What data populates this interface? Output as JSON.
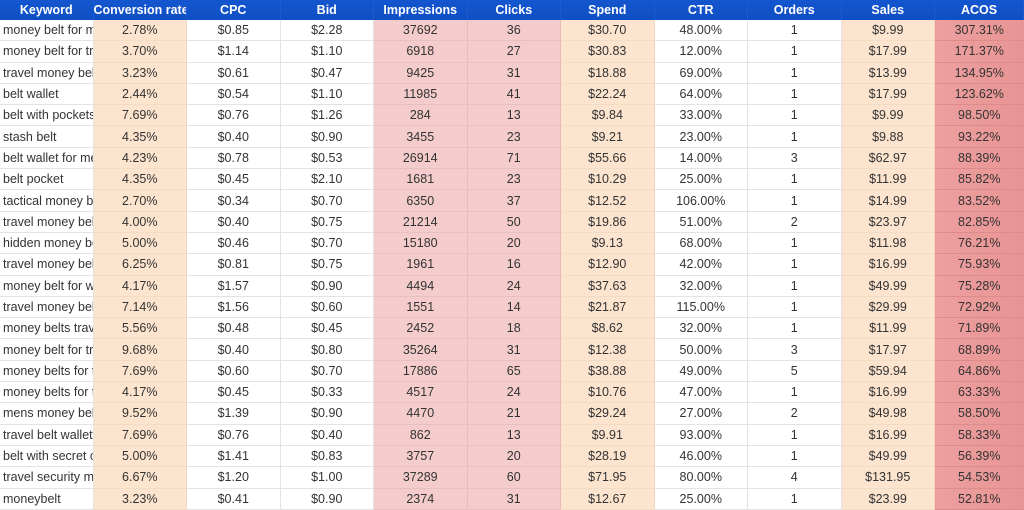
{
  "table": {
    "columns": [
      "Keyword",
      "Conversion rate",
      "CPC",
      "Bid",
      "Impressions",
      "Clicks",
      "Spend",
      "CTR",
      "Orders",
      "Sales",
      "ACOS"
    ],
    "colors": {
      "header_bg": "#1155cc",
      "header_text": "#ffffff",
      "peach": "#fce4cf",
      "pink": "#f4cccc",
      "acos_red": "#ea9999"
    },
    "rows": [
      [
        "money belt for men",
        "2.78%",
        "$0.85",
        "$2.28",
        "37692",
        "36",
        "$30.70",
        "48.00%",
        "1",
        "$9.99",
        "307.31%"
      ],
      [
        "money belt for travel",
        "3.70%",
        "$1.14",
        "$1.10",
        "6918",
        "27",
        "$30.83",
        "12.00%",
        "1",
        "$17.99",
        "171.37%"
      ],
      [
        "travel money belt",
        "3.23%",
        "$0.61",
        "$0.47",
        "9425",
        "31",
        "$18.88",
        "69.00%",
        "1",
        "$13.99",
        "134.95%"
      ],
      [
        "belt wallet",
        "2.44%",
        "$0.54",
        "$1.10",
        "11985",
        "41",
        "$22.24",
        "64.00%",
        "1",
        "$17.99",
        "123.62%"
      ],
      [
        "belt with pockets",
        "7.69%",
        "$0.76",
        "$1.26",
        "284",
        "13",
        "$9.84",
        "33.00%",
        "1",
        "$9.99",
        "98.50%"
      ],
      [
        "stash belt",
        "4.35%",
        "$0.40",
        "$0.90",
        "3455",
        "23",
        "$9.21",
        "23.00%",
        "1",
        "$9.88",
        "93.22%"
      ],
      [
        "belt wallet for men",
        "4.23%",
        "$0.78",
        "$0.53",
        "26914",
        "71",
        "$55.66",
        "14.00%",
        "3",
        "$62.97",
        "88.39%"
      ],
      [
        "belt pocket",
        "4.35%",
        "$0.45",
        "$2.10",
        "1681",
        "23",
        "$10.29",
        "25.00%",
        "1",
        "$11.99",
        "85.82%"
      ],
      [
        "tactical money belt",
        "2.70%",
        "$0.34",
        "$0.70",
        "6350",
        "37",
        "$12.52",
        "106.00%",
        "1",
        "$14.99",
        "83.52%"
      ],
      [
        "travel money belt",
        "4.00%",
        "$0.40",
        "$0.75",
        "21214",
        "50",
        "$19.86",
        "51.00%",
        "2",
        "$23.97",
        "82.85%"
      ],
      [
        "hidden money belt",
        "5.00%",
        "$0.46",
        "$0.70",
        "15180",
        "20",
        "$9.13",
        "68.00%",
        "1",
        "$11.98",
        "76.21%"
      ],
      [
        "travel money belt",
        "6.25%",
        "$0.81",
        "$0.75",
        "1961",
        "16",
        "$12.90",
        "42.00%",
        "1",
        "$16.99",
        "75.93%"
      ],
      [
        "money belt for women",
        "4.17%",
        "$1.57",
        "$0.90",
        "4494",
        "24",
        "$37.63",
        "32.00%",
        "1",
        "$49.99",
        "75.28%"
      ],
      [
        "travel money belt",
        "7.14%",
        "$1.56",
        "$0.60",
        "1551",
        "14",
        "$21.87",
        "115.00%",
        "1",
        "$29.99",
        "72.92%"
      ],
      [
        "money belts travel",
        "5.56%",
        "$0.48",
        "$0.45",
        "2452",
        "18",
        "$8.62",
        "32.00%",
        "1",
        "$11.99",
        "71.89%"
      ],
      [
        "money belt for travel",
        "9.68%",
        "$0.40",
        "$0.80",
        "35264",
        "31",
        "$12.38",
        "50.00%",
        "3",
        "$17.97",
        "68.89%"
      ],
      [
        "money belts for travel",
        "7.69%",
        "$0.60",
        "$0.70",
        "17886",
        "65",
        "$38.88",
        "49.00%",
        "5",
        "$59.94",
        "64.86%"
      ],
      [
        "money belts for travel",
        "4.17%",
        "$0.45",
        "$0.33",
        "4517",
        "24",
        "$10.76",
        "47.00%",
        "1",
        "$16.99",
        "63.33%"
      ],
      [
        "mens money belt",
        "9.52%",
        "$1.39",
        "$0.90",
        "4470",
        "21",
        "$29.24",
        "27.00%",
        "2",
        "$49.98",
        "58.50%"
      ],
      [
        "travel belt wallet",
        "7.69%",
        "$0.76",
        "$0.40",
        "862",
        "13",
        "$9.91",
        "93.00%",
        "1",
        "$16.99",
        "58.33%"
      ],
      [
        "belt with secret compartment",
        "5.00%",
        "$1.41",
        "$0.83",
        "3757",
        "20",
        "$28.19",
        "46.00%",
        "1",
        "$49.99",
        "56.39%"
      ],
      [
        "travel security money belt",
        "6.67%",
        "$1.20",
        "$1.00",
        "37289",
        "60",
        "$71.95",
        "80.00%",
        "4",
        "$131.95",
        "54.53%"
      ],
      [
        "moneybelt",
        "3.23%",
        "$0.41",
        "$0.90",
        "2374",
        "31",
        "$12.67",
        "25.00%",
        "1",
        "$23.99",
        "52.81%"
      ]
    ]
  }
}
